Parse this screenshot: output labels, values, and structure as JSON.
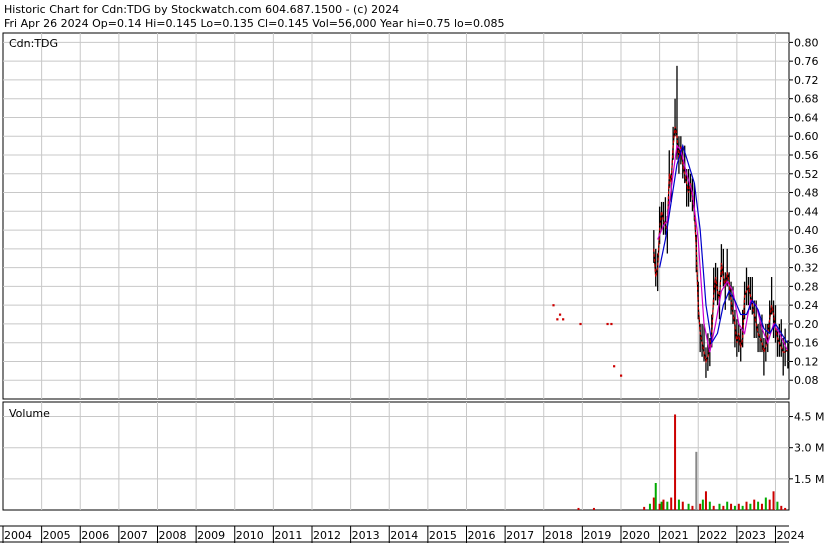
{
  "header": {
    "line1": "Historic Chart for Cdn:TDG by Stockwatch.com 604.687.1500 - (c) 2024",
    "line2": "Fri Apr 26 2024   Op=0.14  Hi=0.145  Lo=0.135  Cl=0.145  Vol=56,000  Year hi=0.75  lo=0.085"
  },
  "colors": {
    "grid": "#c8c8c8",
    "price_line": "#000000",
    "close_dots": "#cc0000",
    "ma_short": "#cc00cc",
    "ma_long": "#0000cc",
    "volume_up": "#00aa00",
    "volume_down": "#cc0000",
    "volume_other": "#888888"
  },
  "chart_data": [
    {
      "type": "line",
      "ticker_label": "Cdn:TDG",
      "ylim": [
        0.04,
        0.82
      ],
      "yticks": [
        0.8,
        0.76,
        0.72,
        0.68,
        0.64,
        0.6,
        0.56,
        0.52,
        0.48,
        0.44,
        0.4,
        0.36,
        0.32,
        0.28,
        0.24,
        0.2,
        0.16,
        0.12,
        0.08
      ],
      "ytick_labels": [
        "0.80",
        "0.76",
        "0.72",
        "0.68",
        "0.64",
        "0.60",
        "0.56",
        "0.52",
        "0.48",
        "0.44",
        "0.40",
        "0.36",
        "0.32",
        "0.28",
        "0.24",
        "0.20",
        "0.16",
        "0.12",
        "0.08"
      ],
      "xlim": [
        2004.0,
        2024.35
      ],
      "grid": true,
      "sparse_closes": {
        "x": [
          2018.25,
          2018.35,
          2018.42,
          2018.5,
          2018.95,
          2019.65,
          2019.75,
          2019.82,
          2020.0
        ],
        "y": [
          0.24,
          0.21,
          0.22,
          0.21,
          0.2,
          0.2,
          0.2,
          0.11,
          0.09
        ]
      },
      "series": [
        {
          "values_x": [
            2020.85,
            2020.9,
            2020.95,
            2021.0,
            2021.05,
            2021.1,
            2021.15,
            2021.2,
            2021.25,
            2021.3,
            2021.35,
            2021.4,
            2021.45,
            2021.5,
            2021.55,
            2021.6,
            2021.65,
            2021.7,
            2021.75,
            2021.8,
            2021.85,
            2021.9,
            2021.95,
            2022.0,
            2022.05,
            2022.1,
            2022.15,
            2022.2,
            2022.25,
            2022.3,
            2022.35,
            2022.4,
            2022.45,
            2022.5,
            2022.55,
            2022.6,
            2022.65,
            2022.7,
            2022.75,
            2022.8,
            2022.85,
            2022.9,
            2022.95,
            2023.0,
            2023.05,
            2023.1,
            2023.15,
            2023.2,
            2023.25,
            2023.3,
            2023.35,
            2023.4,
            2023.45,
            2023.5,
            2023.55,
            2023.6,
            2023.65,
            2023.7,
            2023.75,
            2023.8,
            2023.85,
            2023.9,
            2023.95,
            2024.0,
            2024.05,
            2024.1,
            2024.15,
            2024.2,
            2024.25,
            2024.32
          ],
          "values_y": [
            0.36,
            0.3,
            0.32,
            0.4,
            0.44,
            0.42,
            0.41,
            0.4,
            0.52,
            0.5,
            0.58,
            0.62,
            0.6,
            0.55,
            0.58,
            0.54,
            0.52,
            0.5,
            0.48,
            0.5,
            0.47,
            0.44,
            0.36,
            0.24,
            0.18,
            0.16,
            0.14,
            0.12,
            0.13,
            0.15,
            0.18,
            0.26,
            0.3,
            0.27,
            0.25,
            0.33,
            0.3,
            0.28,
            0.31,
            0.29,
            0.25,
            0.22,
            0.2,
            0.16,
            0.18,
            0.15,
            0.17,
            0.26,
            0.27,
            0.28,
            0.26,
            0.24,
            0.22,
            0.2,
            0.18,
            0.17,
            0.16,
            0.14,
            0.15,
            0.18,
            0.21,
            0.24,
            0.22,
            0.19,
            0.17,
            0.16,
            0.15,
            0.14,
            0.14,
            0.145
          ]
        },
        {
          "values_x": [
            2020.95,
            2021.1,
            2021.2,
            2021.35,
            2021.45,
            2021.55,
            2021.7,
            2021.85,
            2022.0,
            2022.15,
            2022.3,
            2022.45,
            2022.6,
            2022.75,
            2022.9,
            2023.05,
            2023.2,
            2023.35,
            2023.5,
            2023.65,
            2023.8,
            2023.95,
            2024.1,
            2024.3
          ],
          "values_y": [
            0.38,
            0.41,
            0.42,
            0.52,
            0.58,
            0.57,
            0.52,
            0.48,
            0.38,
            0.2,
            0.14,
            0.2,
            0.27,
            0.29,
            0.27,
            0.2,
            0.18,
            0.25,
            0.24,
            0.19,
            0.16,
            0.2,
            0.18,
            0.145
          ]
        },
        {
          "values_x": [
            2021.0,
            2021.15,
            2021.3,
            2021.45,
            2021.6,
            2021.75,
            2021.9,
            2022.05,
            2022.2,
            2022.35,
            2022.5,
            2022.65,
            2022.8,
            2022.95,
            2023.1,
            2023.25,
            2023.4,
            2023.55,
            2023.7,
            2023.85,
            2024.0,
            2024.15,
            2024.3
          ],
          "values_y": [
            0.32,
            0.38,
            0.46,
            0.54,
            0.58,
            0.54,
            0.5,
            0.4,
            0.24,
            0.16,
            0.18,
            0.24,
            0.27,
            0.25,
            0.22,
            0.22,
            0.25,
            0.23,
            0.19,
            0.18,
            0.2,
            0.18,
            0.16
          ]
        }
      ]
    },
    {
      "type": "bar",
      "title": "Volume",
      "ylim": [
        0,
        5.2
      ],
      "ytick_labels": [
        "4.5 M",
        "3.0 M",
        "1.5 M"
      ],
      "yticks": [
        4.5,
        3.0,
        1.5
      ],
      "bars": {
        "x": [
          2018.9,
          2019.3,
          2020.6,
          2020.75,
          2020.85,
          2020.9,
          2021.0,
          2021.05,
          2021.1,
          2021.2,
          2021.3,
          2021.4,
          2021.5,
          2021.6,
          2021.75,
          2021.85,
          2021.95,
          2022.05,
          2022.12,
          2022.2,
          2022.3,
          2022.4,
          2022.55,
          2022.65,
          2022.75,
          2022.85,
          2022.95,
          2023.05,
          2023.15,
          2023.25,
          2023.35,
          2023.45,
          2023.55,
          2023.65,
          2023.75,
          2023.85,
          2023.95,
          2024.05,
          2024.15,
          2024.25
        ],
        "values": [
          0.1,
          0.1,
          0.15,
          0.3,
          0.6,
          1.3,
          0.3,
          0.4,
          0.5,
          0.4,
          0.6,
          4.6,
          0.5,
          0.4,
          0.3,
          0.2,
          2.8,
          0.3,
          0.5,
          0.9,
          0.4,
          0.2,
          0.3,
          0.2,
          0.4,
          0.3,
          0.2,
          0.3,
          0.2,
          0.4,
          0.3,
          0.5,
          0.4,
          0.3,
          0.6,
          0.5,
          0.9,
          0.4,
          0.2,
          0.1
        ],
        "colors": [
          "down",
          "down",
          "down",
          "up",
          "down",
          "up",
          "down",
          "up",
          "down",
          "up",
          "down",
          "down",
          "up",
          "down",
          "up",
          "down",
          "other",
          "down",
          "up",
          "down",
          "up",
          "down",
          "up",
          "down",
          "up",
          "down",
          "up",
          "down",
          "up",
          "down",
          "up",
          "down",
          "up",
          "down",
          "up",
          "down",
          "down",
          "up",
          "down",
          "down"
        ]
      }
    }
  ],
  "x_axis": {
    "years": [
      "2004",
      "2005",
      "2006",
      "2007",
      "2008",
      "2009",
      "2010",
      "2011",
      "2012",
      "2013",
      "2014",
      "2015",
      "2016",
      "2017",
      "2018",
      "2019",
      "2020",
      "2021",
      "2022",
      "2023",
      "2024"
    ]
  }
}
